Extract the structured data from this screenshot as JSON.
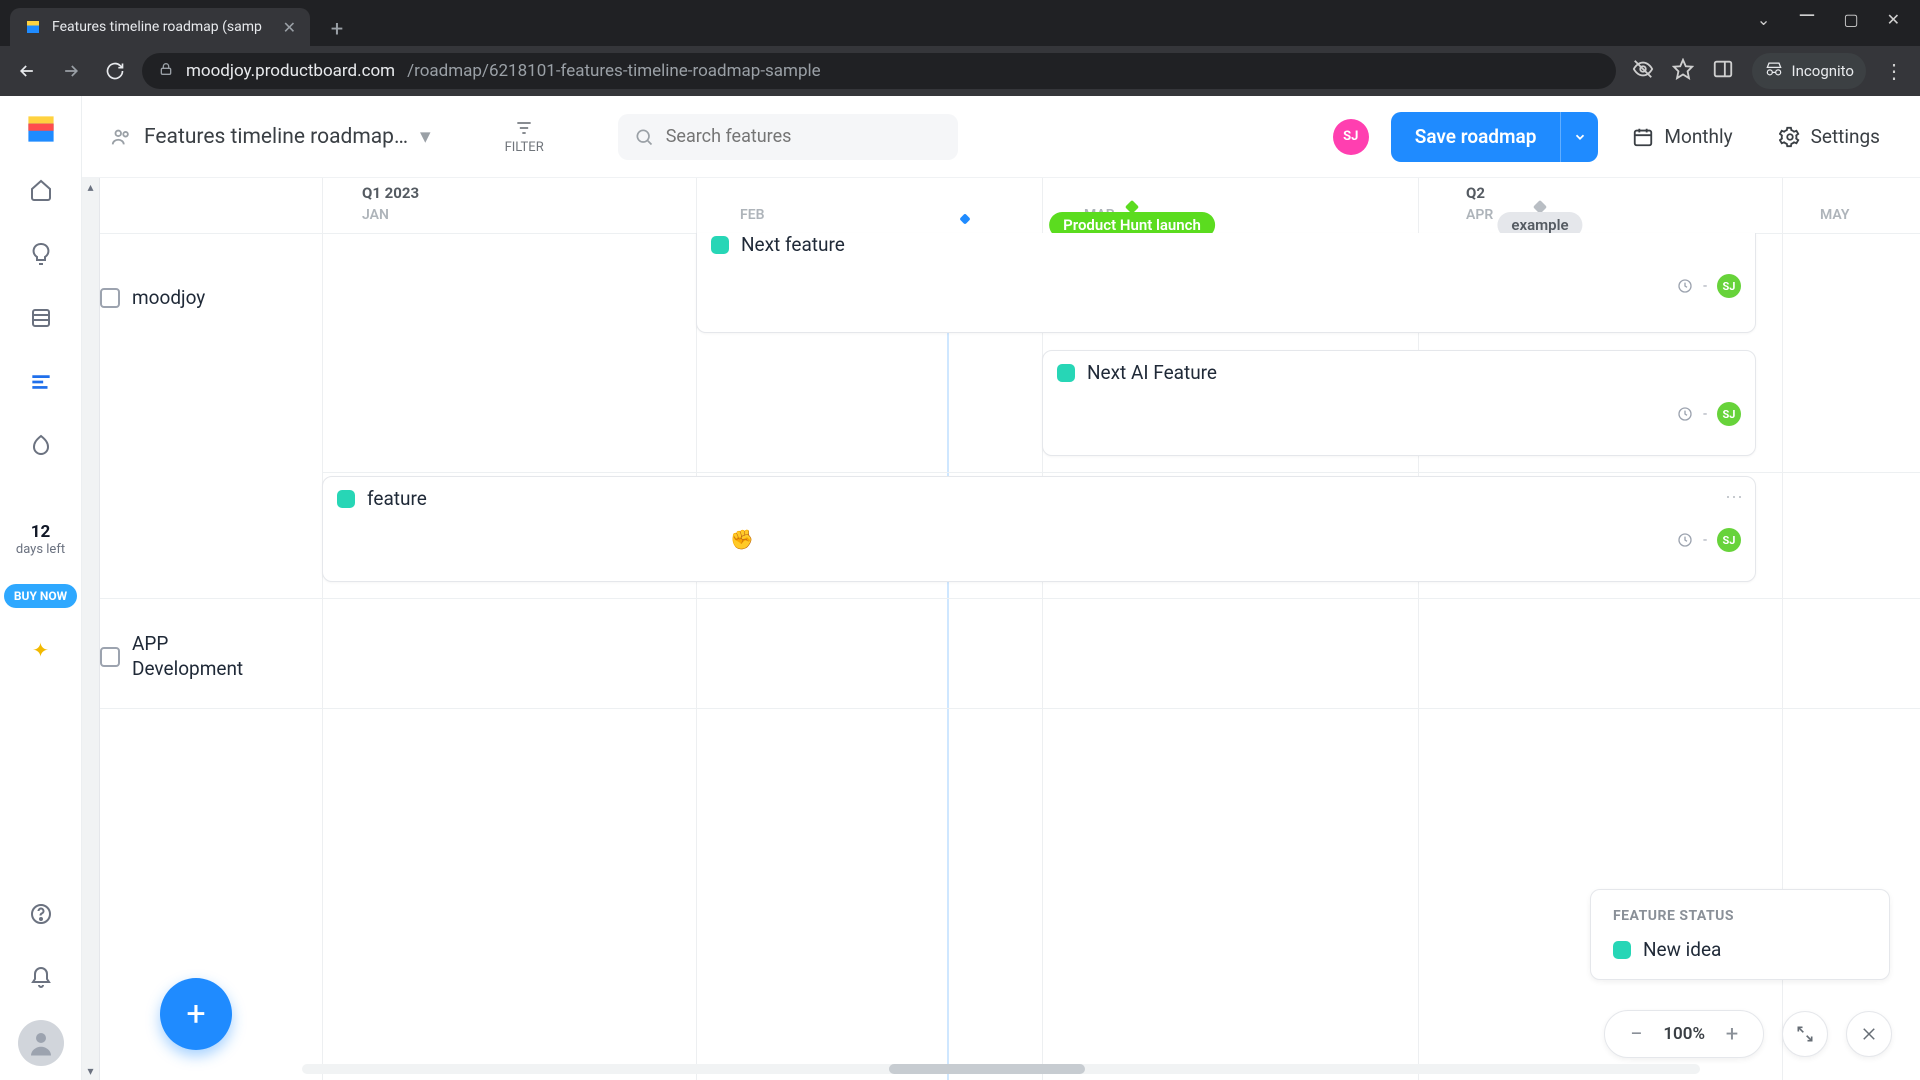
{
  "browser": {
    "tab_title": "Features timeline roadmap (samp",
    "url_domain": "moodjoy.productboard.com",
    "url_path": "/roadmap/6218101-features-timeline-roadmap-sample",
    "incognito_label": "Incognito"
  },
  "rail": {
    "trial_days": "12",
    "trial_label": "days left",
    "buy_now": "BUY NOW"
  },
  "topbar": {
    "crumb": "Features timeline roadmap…",
    "filter": "FILTER",
    "search_placeholder": "Search features",
    "me_initials": "SJ",
    "save": "Save roadmap",
    "view_mode": "Monthly",
    "settings": "Settings"
  },
  "timeline": {
    "q1_label": "Q1 2023",
    "q2_label": "Q2",
    "months": {
      "jan": "JAN",
      "feb": "FEB",
      "mar": "MAR",
      "apr": "APR",
      "may": "MAY"
    },
    "milestones": {
      "mar": "Product Hunt launch",
      "apr": "example"
    },
    "groups": {
      "g1": "moodjoy",
      "g2": "APP Development"
    },
    "cards": {
      "c1_title": "Next feature",
      "c2_title": "Next AI Feature",
      "c3_title": "feature",
      "assignee_initials": "SJ",
      "date_placeholder": "-"
    }
  },
  "legend": {
    "title": "FEATURE STATUS",
    "item1": "New idea"
  },
  "zoom": {
    "pct": "100%"
  },
  "colors": {
    "teal": "#27d6b6",
    "green_pill": "#5bdc1f",
    "grey_pill": "#e5e7eb",
    "assignee": "#67d33a",
    "primary": "#1f8bff",
    "pink": "#ff3fb0"
  }
}
